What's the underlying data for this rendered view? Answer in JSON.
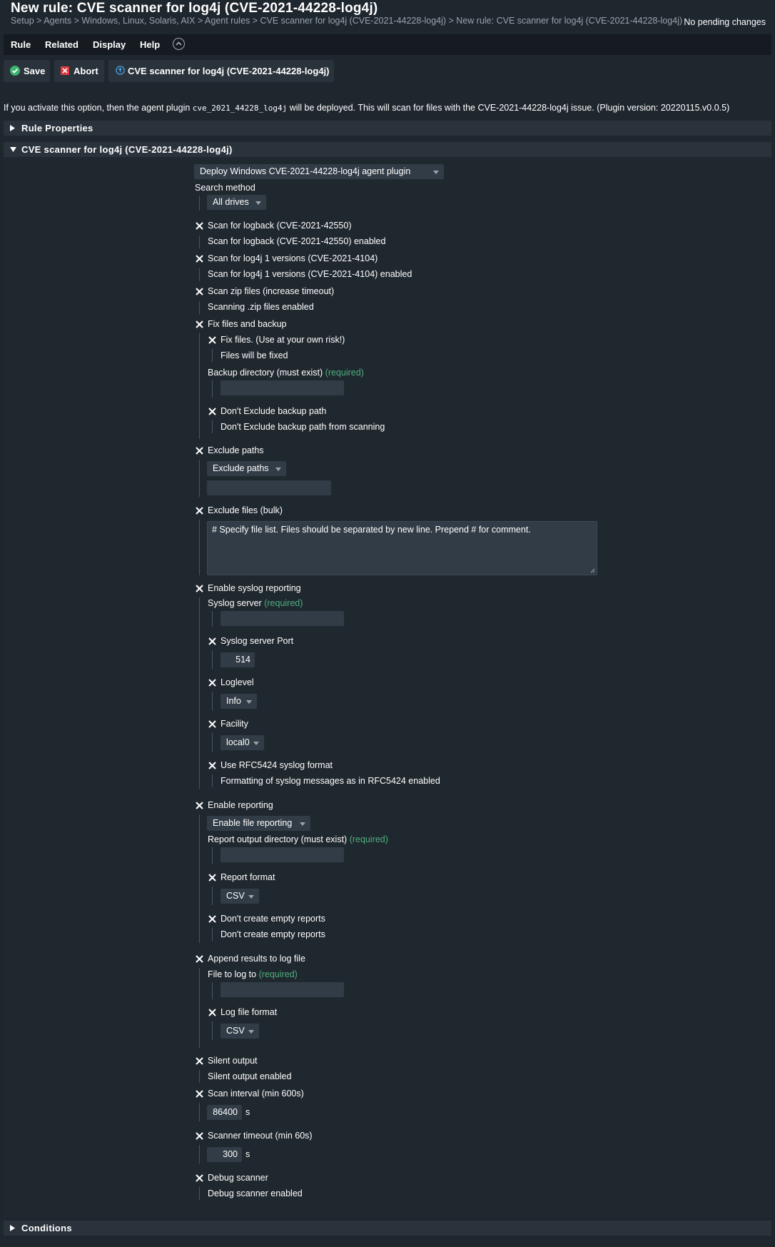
{
  "header": {
    "title": "New rule: CVE scanner for log4j (CVE-2021-44228-log4j)",
    "breadcrumb": "Setup > Agents > Windows, Linux, Solaris, AIX > Agent rules > CVE scanner for log4j (CVE-2021-44228-log4j) > New rule: CVE scanner for log4j (CVE-2021-44228-log4j)",
    "pending_changes": "No pending changes"
  },
  "menu": {
    "rule": "Rule",
    "related": "Related",
    "display": "Display",
    "help": "Help"
  },
  "toolbar": {
    "save": "Save",
    "abort": "Abort",
    "plugin": "CVE scanner for log4j (CVE-2021-44228-log4j)"
  },
  "info": {
    "before": "If you activate this option, then the agent plugin ",
    "code": "cve_2021_44228_log4j",
    "after": " will be deployed. This will scan for files with the CVE-2021-44228-log4j issue. (Plugin version: 20220115.v0.0.5)"
  },
  "sections": {
    "rule_properties": "Rule Properties",
    "cve_scanner": "CVE scanner for log4j (CVE-2021-44228-log4j)",
    "conditions": "Conditions"
  },
  "form": {
    "deploy": "Deploy Windows CVE-2021-44228-log4j agent plugin",
    "search_method_label": "Search method",
    "search_method": "All drives",
    "logback_label": "Scan for logback (CVE-2021-42550)",
    "logback_desc": "Scan for logback (CVE-2021-42550) enabled",
    "log4j1_label": "Scan for log4j 1 versions (CVE-2021-4104)",
    "log4j1_desc": "Scan for log4j 1 versions (CVE-2021-4104) enabled",
    "zip_label": "Scan zip files (increase timeout)",
    "zip_desc": "Scanning .zip files enabled",
    "fix_label": "Fix files and backup",
    "fix_files_label": "Fix files. (Use at your own risk!)",
    "fix_files_desc": "Files will be fixed",
    "backup_dir_label": "Backup directory (must exist)",
    "required": "(required)",
    "dont_exclude_label": "Don't Exclude backup path",
    "dont_exclude_desc": "Don't Exclude backup path from scanning",
    "exclude_paths_label": "Exclude paths",
    "exclude_paths_select": "Exclude paths",
    "exclude_files_label": "Exclude files (bulk)",
    "exclude_files_text": "# Specify file list. Files should be separated by new line. Prepend # for comment.",
    "syslog_label": "Enable syslog reporting",
    "syslog_server_label": "Syslog server",
    "syslog_port_label": "Syslog server Port",
    "syslog_port": "514",
    "loglevel_label": "Loglevel",
    "loglevel": "Info",
    "facility_label": "Facility",
    "facility": "local0",
    "rfc_label": "Use RFC5424 syslog format",
    "rfc_desc": "Formatting of syslog messages as in RFC5424 enabled",
    "reporting_label": "Enable reporting",
    "reporting_select": "Enable file reporting",
    "report_dir_label": "Report output directory (must exist)",
    "report_format_label": "Report format",
    "report_format": "CSV",
    "empty_reports_label": "Don't create empty reports",
    "empty_reports_desc": "Don't create empty reports",
    "append_label": "Append results to log file",
    "file_to_log_label": "File to log to",
    "log_format_label": "Log file format",
    "log_format": "CSV",
    "silent_label": "Silent output",
    "silent_desc": "Silent output enabled",
    "interval_label": "Scan interval (min 600s)",
    "interval": "86400",
    "unit_s": "s",
    "timeout_label": "Scanner timeout (min 60s)",
    "timeout": "300",
    "debug_label": "Debug scanner",
    "debug_desc": "Debug scanner enabled"
  }
}
